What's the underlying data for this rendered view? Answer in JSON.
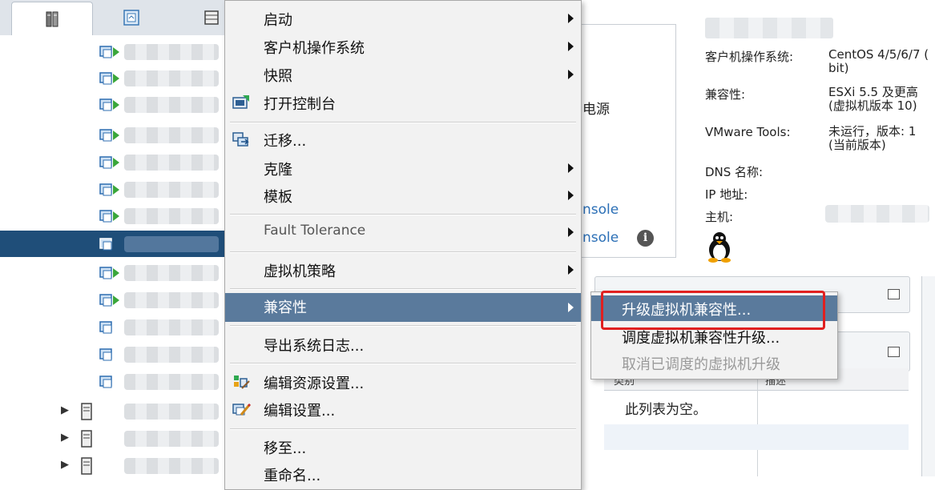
{
  "navigator": {
    "tabs": [
      {
        "icon": "hosts-clusters-icon"
      },
      {
        "icon": "vms-templates-icon"
      },
      {
        "icon": "storage-icon"
      }
    ]
  },
  "context_menu": {
    "items": [
      {
        "label": "启动",
        "has_submenu": true
      },
      {
        "label": "客户机操作系统",
        "has_submenu": true
      },
      {
        "label": "快照",
        "has_submenu": true
      },
      {
        "label": "打开控制台",
        "icon": "console-icon"
      },
      {
        "label": "迁移...",
        "icon": "migrate-icon"
      },
      {
        "label": "克隆",
        "has_submenu": true
      },
      {
        "label": "模板",
        "has_submenu": true
      },
      {
        "label": "Fault Tolerance",
        "has_submenu": true
      },
      {
        "label": "虚拟机策略",
        "has_submenu": true
      },
      {
        "label": "兼容性",
        "has_submenu": true,
        "highlighted": true
      },
      {
        "label": "导出系统日志..."
      },
      {
        "label": "编辑资源设置...",
        "icon": "resource-settings-icon"
      },
      {
        "label": "编辑设置...",
        "icon": "edit-settings-icon"
      },
      {
        "label": "移至..."
      },
      {
        "label": "重命名..."
      }
    ]
  },
  "submenu": {
    "items": [
      {
        "label": "升级虚拟机兼容性...",
        "highlighted": true
      },
      {
        "label": "调度虚拟机兼容性升级..."
      },
      {
        "label": "取消已调度的虚拟机升级",
        "disabled": true
      }
    ]
  },
  "summary": {
    "power_text": "电源",
    "console_link_1": "nsole",
    "console_link_2": "nsole",
    "properties": [
      {
        "label": "客户机操作系统:",
        "value": "CentOS 4/5/6/7 (\nbit)"
      },
      {
        "label": "兼容性:",
        "value": "ESXi 5.5 及更高\n(虚拟机版本 10)"
      },
      {
        "label": "VMware Tools:",
        "value": "未运行，版本: 1\n(当前版本)"
      },
      {
        "label": "DNS 名称:",
        "value": ""
      },
      {
        "label": "IP 地址:",
        "value": ""
      },
      {
        "label": "主机:",
        "value": ""
      }
    ]
  },
  "table": {
    "col_type": "类别",
    "col_desc": "描述",
    "empty_text": "此列表为空。"
  },
  "colors": {
    "menu_highlight": "#5a7a9c",
    "selection": "#1f4e79",
    "link": "#2b6fb6",
    "callout_red": "#e02020"
  }
}
